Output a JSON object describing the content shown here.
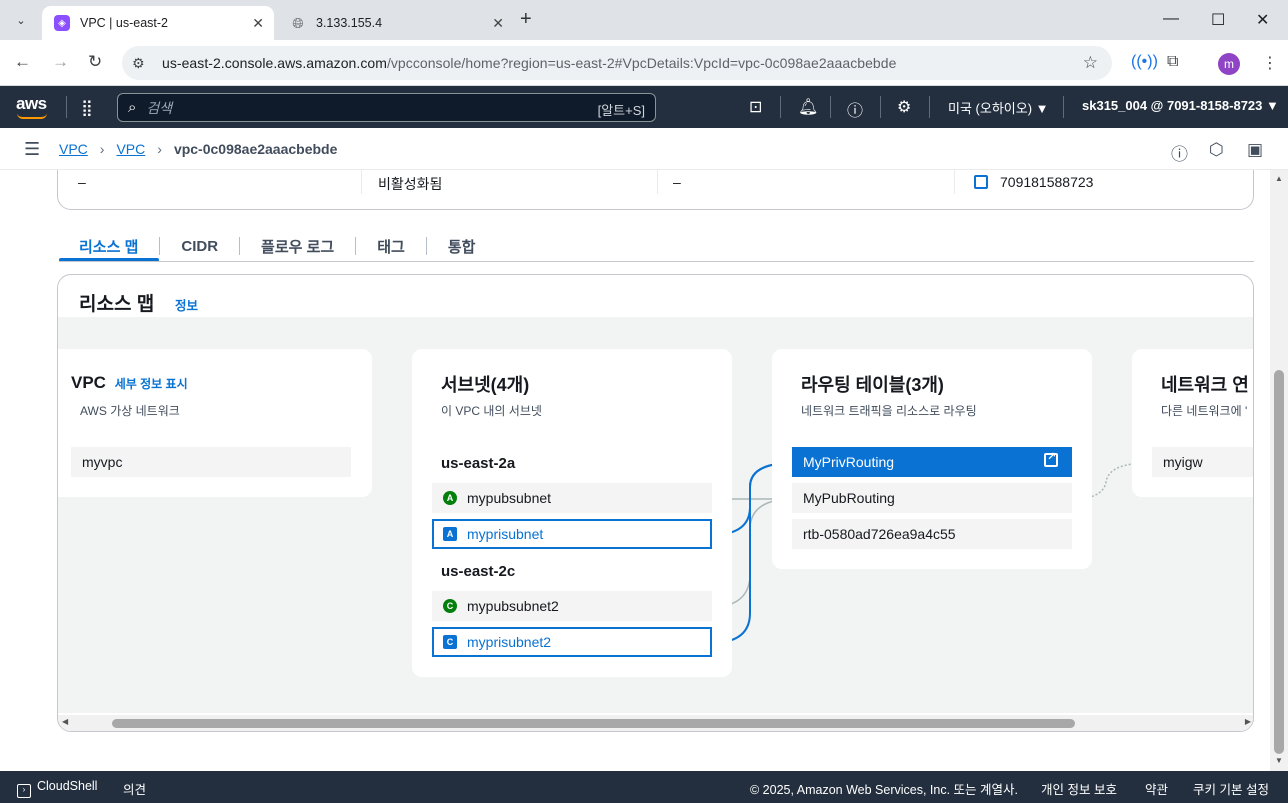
{
  "browser": {
    "tabs": [
      {
        "title": "VPC | us-east-2",
        "active": true
      },
      {
        "title": "3.133.155.4",
        "active": false
      }
    ],
    "url_host": "us-east-2.console.aws.amazon.com",
    "url_path": "/vpcconsole/home?region=us-east-2#VpcDetails:VpcId=vpc-0c098ae2aaacbebde",
    "profile_initial": "m"
  },
  "aws_nav": {
    "logo": "aws",
    "search_placeholder": "검색",
    "search_shortcut": "[알트+S]",
    "region": "미국 (오하이오) ▼",
    "account": "sk315_004 @ 7091-8158-8723 ▼"
  },
  "breadcrumb": {
    "items": [
      "VPC",
      "VPC"
    ],
    "current": "vpc-0c098ae2aaacbebde"
  },
  "details_row": {
    "cells": [
      "–",
      "비활성화됨",
      "–",
      "709181588723"
    ]
  },
  "tabs": [
    "리소스 맵",
    "CIDR",
    "플로우 로그",
    "태그",
    "통합"
  ],
  "resource_map": {
    "title": "리소스 맵",
    "info": "정보",
    "vpc": {
      "heading": "VPC",
      "details_link": "세부 정보 표시",
      "subtitle": "AWS 가상 네트워크",
      "name": "myvpc"
    },
    "subnets": {
      "heading": "서브넷(4개)",
      "subtitle": "이 VPC 내의 서브넷",
      "az1": "us-east-2a",
      "az2": "us-east-2c",
      "items": [
        {
          "badge": "A",
          "name": "mypubsubnet"
        },
        {
          "badge": "A",
          "name": "myprisubnet"
        },
        {
          "badge": "C",
          "name": "mypubsubnet2"
        },
        {
          "badge": "C",
          "name": "myprisubnet2"
        }
      ]
    },
    "route_tables": {
      "heading": "라우팅 테이블(3개)",
      "subtitle": "네트워크 트래픽을 리소스로 라우팅",
      "items": [
        "MyPrivRouting",
        "MyPubRouting",
        "rtb-0580ad726ea9a4c55"
      ]
    },
    "network_connections": {
      "heading": "네트워크 연",
      "subtitle": "다른 네트워크에 '",
      "items": [
        "myigw"
      ]
    }
  },
  "footer": {
    "cloudshell": "CloudShell",
    "feedback": "의견",
    "copyright": "© 2025, Amazon Web Services, Inc. 또는 계열사.",
    "privacy": "개인 정보 보호",
    "terms": "약관",
    "cookies": "쿠키 기본 설정"
  },
  "colors": {
    "accent": "#0972d3",
    "nav_bg": "#232f3e",
    "public_badge": "#037f0c"
  }
}
